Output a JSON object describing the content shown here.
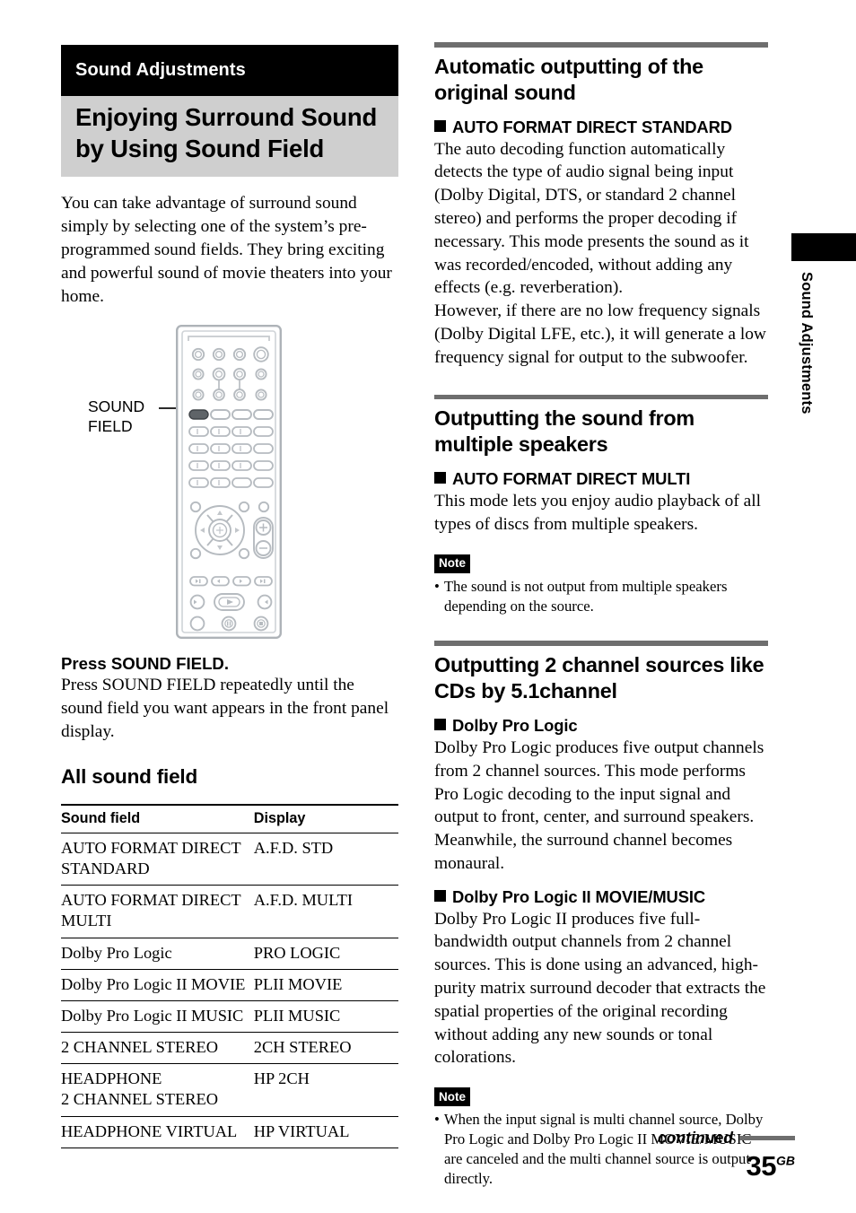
{
  "chapter": {
    "band_label": "Sound Adjustments",
    "title": "Enjoying Surround Sound by Using Sound Field",
    "side_tab_label": "Sound Adjustments"
  },
  "left": {
    "intro_paragraph": "You can take advantage of surround sound simply by selecting one of the system’s pre-programmed sound fields. They bring exciting and powerful sound of movie theaters into your home.",
    "remote_callout": "SOUND\nFIELD",
    "press_heading": "Press SOUND FIELD.",
    "press_paragraph": "Press SOUND FIELD repeatedly until the sound field you want appears in the front panel display.",
    "all_sound_field_heading": "All sound field",
    "table": {
      "headers": [
        "Sound field",
        "Display"
      ],
      "rows": [
        [
          "AUTO FORMAT DIRECT STANDARD",
          "A.F.D. STD"
        ],
        [
          "AUTO FORMAT DIRECT MULTI",
          "A.F.D. MULTI"
        ],
        [
          "Dolby Pro Logic",
          "PRO LOGIC"
        ],
        [
          "Dolby Pro Logic II MOVIE",
          "PLII MOVIE"
        ],
        [
          "Dolby Pro Logic II MUSIC",
          "PLII MUSIC"
        ],
        [
          "2 CHANNEL STEREO",
          "2CH STEREO"
        ],
        [
          "HEADPHONE\n2 CHANNEL STEREO",
          "HP 2CH"
        ],
        [
          "HEADPHONE VIRTUAL",
          "HP VIRTUAL"
        ]
      ]
    }
  },
  "right": {
    "section1": {
      "heading": "Automatic outputting of the original sound",
      "mode_heading": "AUTO FORMAT DIRECT STANDARD",
      "paragraph1": "The auto decoding function automatically detects the type of audio signal being input (Dolby Digital, DTS, or standard 2 channel stereo) and performs the proper decoding if necessary. This mode presents the sound as it was recorded/encoded, without adding any effects (e.g. reverberation).",
      "paragraph2": "However, if there are no low frequency signals (Dolby Digital LFE, etc.), it will generate a low frequency signal for output to the subwoofer."
    },
    "section2": {
      "heading": "Outputting the sound from multiple speakers",
      "mode_heading": "AUTO FORMAT DIRECT MULTI",
      "paragraph1": "This mode lets you enjoy audio playback of all types of discs from multiple speakers.",
      "note_badge": "Note",
      "note_items": [
        "The sound is not output from multiple speakers depending on the source."
      ]
    },
    "section3": {
      "heading": "Outputting 2 channel sources like CDs by 5.1channel",
      "mode_heading_a": "Dolby Pro Logic",
      "paragraph_a": "Dolby Pro Logic produces five output channels from 2 channel sources. This mode performs Pro Logic decoding to the input signal and output to front, center, and surround speakers. Meanwhile, the surround channel becomes monaural.",
      "mode_heading_b": "Dolby Pro Logic II MOVIE/MUSIC",
      "paragraph_b": "Dolby Pro Logic II produces five full-bandwidth output channels from 2 channel sources. This is done using an advanced, high-purity matrix surround decoder that extracts the spatial properties of the original recording without adding any new sounds or tonal colorations.",
      "note_badge": "Note",
      "note_items": [
        "When the input signal is multi channel source, Dolby Pro Logic and Dolby Pro Logic II MOVIE/MUSIC are canceled and the multi channel source is output directly."
      ]
    }
  },
  "footer": {
    "continued_label": "continued",
    "page_number": "35",
    "page_suffix": "GB"
  },
  "colors": {
    "chapter_band": "#000000",
    "title_band": "#cfcfcf",
    "section_rule": "#6e6e6e",
    "remote_outline": "#a8adb2",
    "highlight_button": "#5f6468"
  }
}
